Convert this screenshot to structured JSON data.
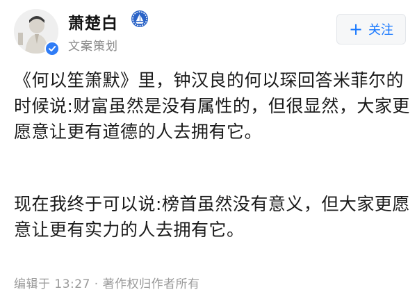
{
  "author": {
    "name": "萧楚白",
    "role": "文案策划",
    "verified": true,
    "badge_icon": "sailboat-badge-icon"
  },
  "follow_button": {
    "icon": "plus-icon",
    "label": "关注",
    "color": "#1677ff"
  },
  "post": {
    "paragraphs": [
      "《何以笙箫默》里，钟汉良的何以琛回答米菲尔的时候说:财富虽然是没有属性的，但很显然，大家更愿意让更有道德的人去拥有它。",
      "现在我终于可以说:榜首虽然没有意义，但大家更愿意让更有实力的人去拥有它。"
    ]
  },
  "footer": {
    "text": "编辑于 13:27 · 著作权归作者所有"
  }
}
